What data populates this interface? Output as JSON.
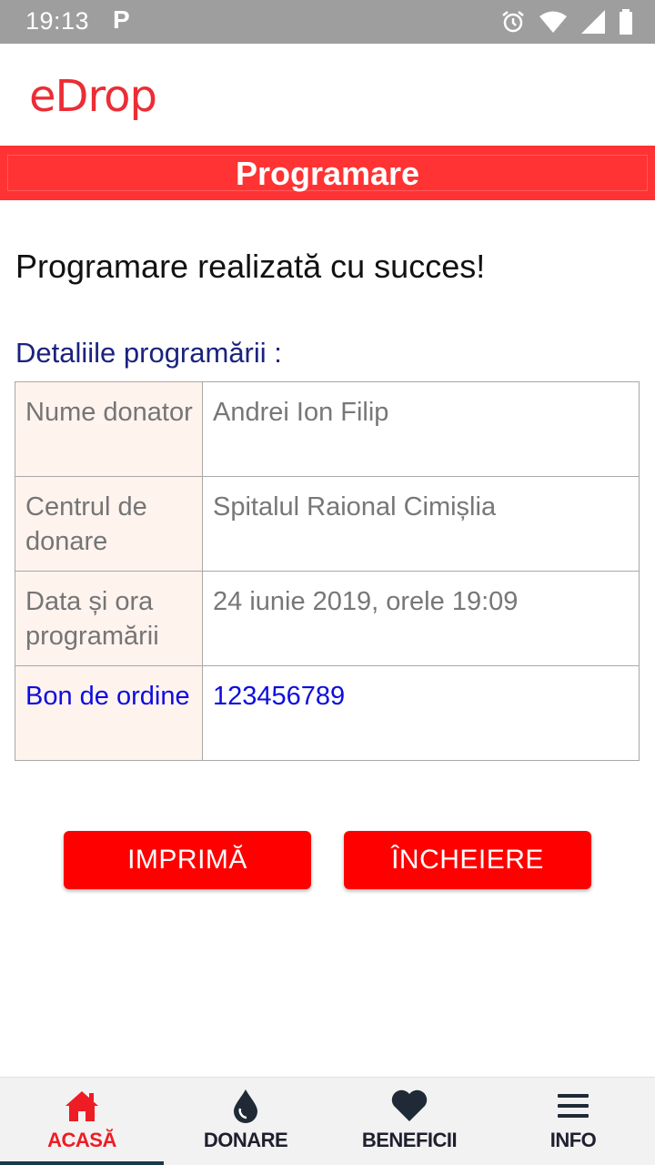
{
  "status_bar": {
    "time": "19:13",
    "notification_letter": "P",
    "icons": [
      "alarm-icon",
      "wifi-icon",
      "signal-icon",
      "battery-icon"
    ]
  },
  "header": {
    "logo_text": "eDrop",
    "brand_color": "#ec2d35"
  },
  "page": {
    "title": "Programare",
    "success_message": "Programare realizată cu succes!",
    "details_heading": "Detaliile programării :"
  },
  "details": {
    "rows": [
      {
        "label": "Nume donator",
        "value": "Andrei Ion Filip"
      },
      {
        "label": "Centrul de donare",
        "value": "Spitalul Raional Cimișlia"
      },
      {
        "label": "Data și ora programării",
        "value": "24 iunie 2019, orele 19:09"
      },
      {
        "label": "Bon de ordine",
        "value": "123456789"
      }
    ]
  },
  "actions": {
    "print_label": "IMPRIMĂ",
    "finish_label": "ÎNCHEIERE",
    "button_color": "#ff0000"
  },
  "bottom_nav": {
    "items": [
      {
        "label": "ACASĂ",
        "icon": "home-icon",
        "active": true
      },
      {
        "label": "DONARE",
        "icon": "drop-icon",
        "active": false
      },
      {
        "label": "BENEFICII",
        "icon": "heart-icon",
        "active": false
      },
      {
        "label": "INFO",
        "icon": "menu-icon",
        "active": false
      }
    ],
    "active_color": "#ee1c24"
  }
}
